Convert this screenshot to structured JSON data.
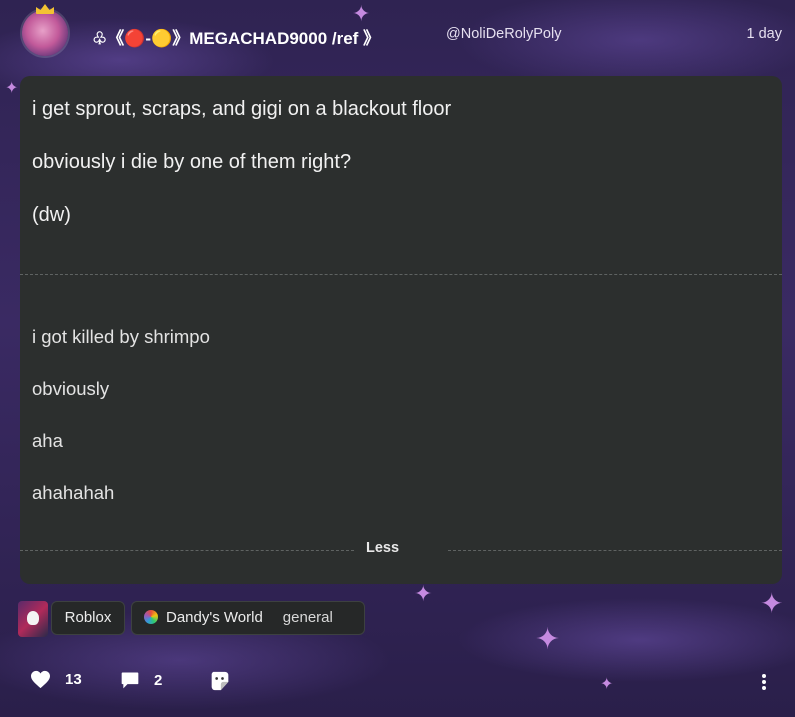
{
  "post": {
    "author": {
      "display_name": "♧《🔴-🟡》MEGACHAD9000 /ref 》",
      "handle": "@NoliDeRolyPoly"
    },
    "timestamp": "1 day",
    "body": {
      "paragraphs": [
        "i get sprout, scraps, and gigi on a blackout floor",
        "obviously i die by one of them right?",
        "(dw)"
      ],
      "continuation": [
        "i got killed by shrimpo",
        "obviously",
        "aha",
        "ahahahah"
      ]
    },
    "less_label": "Less",
    "tags": {
      "game": "Roblox",
      "community": "Dandy's World",
      "channel": "general"
    },
    "actions": {
      "likes": "13",
      "comments": "2"
    }
  },
  "colors": {
    "card_bg": "#2c2f2e",
    "page_bg": "#3a2a63",
    "sparkle": "#c58ae0"
  }
}
